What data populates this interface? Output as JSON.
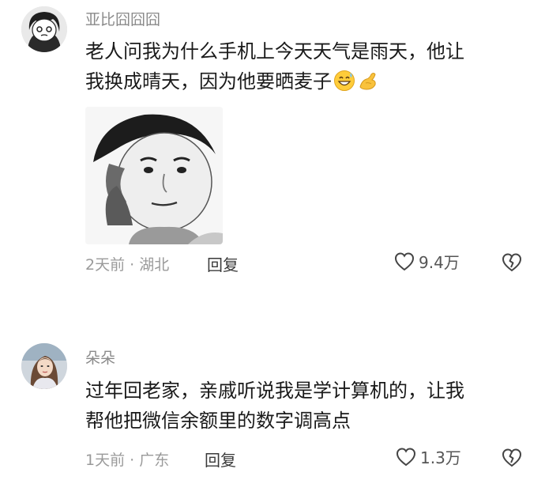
{
  "comments": [
    {
      "username": "亚比囧囧囧",
      "text_lines": [
        "老人问我为什么手机上今天天气是雨天，他让",
        "我换成晴天，因为他要晒麦子"
      ],
      "emojis": [
        "grinning-sweat-face-icon",
        "hand-holding-icon"
      ],
      "time": "2天前",
      "location": "湖北",
      "reply_label": "回复",
      "likes": "9.4万"
    },
    {
      "username": "朵朵",
      "text_lines": [
        "过年回老家，亲戚听说我是学计算机的，让我",
        "帮他把微信余额里的数字调高点"
      ],
      "time": "1天前",
      "location": "广东",
      "reply_label": "回复",
      "likes": "1.3万"
    }
  ],
  "meta_separator": "·",
  "colors": {
    "username": "#8a8a8a",
    "text": "#1a1a1a",
    "meta": "#9a9a9a"
  }
}
